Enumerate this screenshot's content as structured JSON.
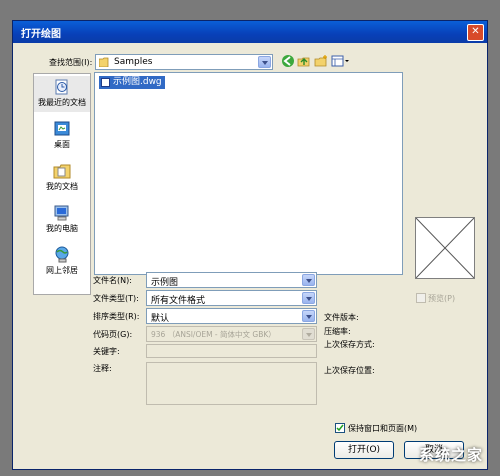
{
  "window": {
    "title": "打开绘图",
    "close_glyph": "✕"
  },
  "lookin": {
    "label": "查找范围(I):",
    "value": "Samples"
  },
  "places": [
    {
      "label": "我最近的文档"
    },
    {
      "label": "桌面"
    },
    {
      "label": "我的文档"
    },
    {
      "label": "我的电脑"
    },
    {
      "label": "网上邻居"
    }
  ],
  "files": [
    {
      "name": "示例图.dwg"
    }
  ],
  "form": {
    "filename_label": "文件名(N):",
    "filename_value": "示例图",
    "filetype_label": "文件类型(T):",
    "filetype_value": "所有文件格式",
    "sort_label": "排序类型(R):",
    "sort_value": "默认",
    "codepage_label": "代码页(G):",
    "codepage_value": "936 （ANSI/OEM - 简体中文 GBK）",
    "keywords_label": "关键字:",
    "comments_label": "注释:"
  },
  "info": {
    "version_label": "文件版本:",
    "compression_label": "压缩率:",
    "last_saved_by_label": "上次保存方式:",
    "last_saved_location_label": "上次保存位置:"
  },
  "preview": {
    "label": "预览(P)"
  },
  "options": {
    "keep_label": "保持窗口和页面(M)"
  },
  "buttons": {
    "open": "打开(O)",
    "cancel": "取消"
  },
  "watermark": "系统之家"
}
